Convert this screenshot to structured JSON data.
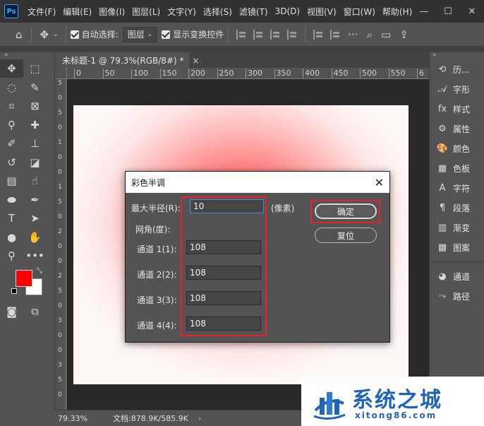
{
  "app": {
    "logo": "Ps",
    "menu": [
      "文件(F)",
      "编辑(E)",
      "图像(I)",
      "图层(L)",
      "文字(Y)",
      "选择(S)",
      "滤镜(T)",
      "3D(D)",
      "视图(V)",
      "窗口(W)",
      "帮助(H)"
    ]
  },
  "options_bar": {
    "auto_select_label": "自动选择:",
    "auto_select_value": "图层",
    "show_transform_label": "显示变换控件"
  },
  "document": {
    "tab_title": "未标题-1 @ 79.3%(RGB/8#) *",
    "ruler_ticks": [
      "0",
      "50",
      "100",
      "150",
      "200",
      "250",
      "300",
      "350",
      "400",
      "450",
      "500",
      "550",
      "6"
    ],
    "ruler_v_ticks": [
      "5",
      "0",
      "5",
      "0",
      "1",
      "0",
      "0",
      "1",
      "5",
      "0",
      "2",
      "0",
      "0",
      "2",
      "5",
      "0",
      "3",
      "0",
      "0",
      "3",
      "5",
      "0"
    ],
    "gradient_colors": [
      "#ff3b3b",
      "#fff6f6"
    ]
  },
  "status": {
    "zoom": "79.33%",
    "doc_info": "文档:878.9K/585.9K"
  },
  "tools": {
    "foreground_color": "#ff0000",
    "background_color": "#ffffff"
  },
  "panels": [
    {
      "label": "历...",
      "icon": "history-icon"
    },
    {
      "label": "字形",
      "icon": "glyphs-icon"
    },
    {
      "label": "样式",
      "icon": "styles-icon"
    },
    {
      "label": "属性",
      "icon": "properties-icon"
    },
    {
      "label": "颜色",
      "icon": "color-palette-icon"
    },
    {
      "label": "色板",
      "icon": "swatches-icon"
    },
    {
      "label": "字符",
      "icon": "character-icon"
    },
    {
      "label": "段落",
      "icon": "paragraph-icon"
    },
    {
      "label": "渐变",
      "icon": "gradient-icon"
    },
    {
      "label": "图案",
      "icon": "pattern-icon"
    },
    {
      "label": "通道",
      "icon": "channels-icon"
    },
    {
      "label": "路径",
      "icon": "paths-icon"
    }
  ],
  "dialog": {
    "title": "彩色半调",
    "max_radius_label": "最大半径(R):",
    "max_radius_value": "10",
    "max_radius_unit": "(像素)",
    "screen_angles_label": "网角(度):",
    "channels": [
      {
        "label": "通道 1(1):",
        "value": "108"
      },
      {
        "label": "通道 2(2):",
        "value": "108"
      },
      {
        "label": "通道 3(3):",
        "value": "108"
      },
      {
        "label": "通道 4(4):",
        "value": "108"
      }
    ],
    "ok_label": "确定",
    "reset_label": "复位",
    "highlight_color": "#e8232a"
  },
  "watermark": {
    "text": "系统之城",
    "url": "xitong86.com"
  }
}
